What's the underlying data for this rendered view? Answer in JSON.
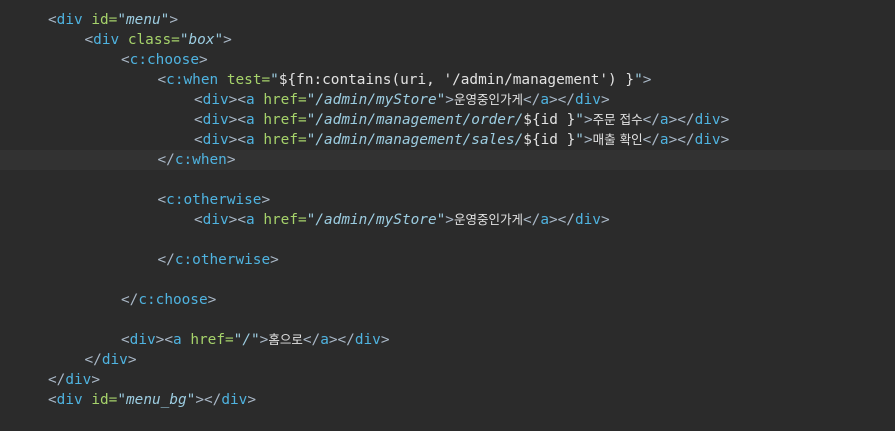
{
  "editor": {
    "background": "#2b2b2b",
    "current_line_background": "#323232",
    "current_line": 7,
    "token_colors": {
      "punctuation": "#a9b7c6",
      "tag": "#4fb3e0",
      "attribute": "#a6d36b",
      "value": "#9ccce0",
      "text": "#e2e2e2"
    },
    "lines": [
      {
        "indent": 0,
        "tokens": [
          [
            "punct",
            "<"
          ],
          [
            "tag",
            "div"
          ],
          [
            "punct",
            " "
          ],
          [
            "attr",
            "id="
          ],
          [
            "val",
            "\"menu\""
          ],
          [
            "punct",
            ">"
          ]
        ]
      },
      {
        "indent": 1,
        "tokens": [
          [
            "punct",
            "<"
          ],
          [
            "tag",
            "div"
          ],
          [
            "punct",
            " "
          ],
          [
            "attr",
            "class="
          ],
          [
            "val",
            "\"box\""
          ],
          [
            "punct",
            ">"
          ]
        ]
      },
      {
        "indent": 2,
        "tokens": [
          [
            "punct",
            "<"
          ],
          [
            "tag",
            "c:choose"
          ],
          [
            "punct",
            ">"
          ]
        ]
      },
      {
        "indent": 3,
        "tokens": [
          [
            "punct",
            "<"
          ],
          [
            "tag",
            "c:when"
          ],
          [
            "punct",
            " "
          ],
          [
            "attr",
            "test="
          ],
          [
            "val",
            "\""
          ],
          [
            "text",
            "${fn:contains(uri, '/admin/management') }"
          ],
          [
            "val",
            "\""
          ],
          [
            "punct",
            ">"
          ]
        ]
      },
      {
        "indent": 4,
        "tokens": [
          [
            "punct",
            "<"
          ],
          [
            "tag",
            "div"
          ],
          [
            "punct",
            "><"
          ],
          [
            "tag",
            "a"
          ],
          [
            "punct",
            " "
          ],
          [
            "attr",
            "href="
          ],
          [
            "val",
            "\"/admin/myStore\""
          ],
          [
            "punct",
            ">"
          ],
          [
            "ko",
            "운영중인가게"
          ],
          [
            "punct",
            "</"
          ],
          [
            "tag",
            "a"
          ],
          [
            "punct",
            "></"
          ],
          [
            "tag",
            "div"
          ],
          [
            "punct",
            ">"
          ]
        ]
      },
      {
        "indent": 4,
        "tokens": [
          [
            "punct",
            "<"
          ],
          [
            "tag",
            "div"
          ],
          [
            "punct",
            "><"
          ],
          [
            "tag",
            "a"
          ],
          [
            "punct",
            " "
          ],
          [
            "attr",
            "href="
          ],
          [
            "val",
            "\"/admin/management/order/"
          ],
          [
            "text",
            "${id }"
          ],
          [
            "val",
            "\""
          ],
          [
            "punct",
            ">"
          ],
          [
            "ko",
            "주문 접수"
          ],
          [
            "punct",
            "</"
          ],
          [
            "tag",
            "a"
          ],
          [
            "punct",
            "></"
          ],
          [
            "tag",
            "div"
          ],
          [
            "punct",
            ">"
          ]
        ]
      },
      {
        "indent": 4,
        "tokens": [
          [
            "punct",
            "<"
          ],
          [
            "tag",
            "div"
          ],
          [
            "punct",
            "><"
          ],
          [
            "tag",
            "a"
          ],
          [
            "punct",
            " "
          ],
          [
            "attr",
            "href="
          ],
          [
            "val",
            "\"/admin/management/sales/"
          ],
          [
            "text",
            "${id }"
          ],
          [
            "val",
            "\""
          ],
          [
            "punct",
            ">"
          ],
          [
            "ko",
            "매출 확인"
          ],
          [
            "punct",
            "</"
          ],
          [
            "tag",
            "a"
          ],
          [
            "punct",
            "></"
          ],
          [
            "tag",
            "div"
          ],
          [
            "punct",
            ">"
          ]
        ]
      },
      {
        "indent": 3,
        "tokens": [
          [
            "punct",
            "</"
          ],
          [
            "tag",
            "c:when"
          ],
          [
            "punct",
            ">"
          ]
        ]
      },
      {
        "indent": 0,
        "tokens": []
      },
      {
        "indent": 3,
        "tokens": [
          [
            "punct",
            "<"
          ],
          [
            "tag",
            "c:otherwise"
          ],
          [
            "punct",
            ">"
          ]
        ]
      },
      {
        "indent": 4,
        "tokens": [
          [
            "punct",
            "<"
          ],
          [
            "tag",
            "div"
          ],
          [
            "punct",
            "><"
          ],
          [
            "tag",
            "a"
          ],
          [
            "punct",
            " "
          ],
          [
            "attr",
            "href="
          ],
          [
            "val",
            "\"/admin/myStore\""
          ],
          [
            "punct",
            ">"
          ],
          [
            "ko",
            "운영중인가게"
          ],
          [
            "punct",
            "</"
          ],
          [
            "tag",
            "a"
          ],
          [
            "punct",
            "></"
          ],
          [
            "tag",
            "div"
          ],
          [
            "punct",
            ">"
          ]
        ]
      },
      {
        "indent": 0,
        "tokens": []
      },
      {
        "indent": 3,
        "tokens": [
          [
            "punct",
            "</"
          ],
          [
            "tag",
            "c:otherwise"
          ],
          [
            "punct",
            ">"
          ]
        ]
      },
      {
        "indent": 0,
        "tokens": []
      },
      {
        "indent": 2,
        "tokens": [
          [
            "punct",
            "</"
          ],
          [
            "tag",
            "c:choose"
          ],
          [
            "punct",
            ">"
          ]
        ]
      },
      {
        "indent": 0,
        "tokens": []
      },
      {
        "indent": 2,
        "tokens": [
          [
            "punct",
            "<"
          ],
          [
            "tag",
            "div"
          ],
          [
            "punct",
            "><"
          ],
          [
            "tag",
            "a"
          ],
          [
            "punct",
            " "
          ],
          [
            "attr",
            "href="
          ],
          [
            "val",
            "\"/\""
          ],
          [
            "punct",
            ">"
          ],
          [
            "ko",
            "홈으로"
          ],
          [
            "punct",
            "</"
          ],
          [
            "tag",
            "a"
          ],
          [
            "punct",
            "></"
          ],
          [
            "tag",
            "div"
          ],
          [
            "punct",
            ">"
          ]
        ]
      },
      {
        "indent": 1,
        "tokens": [
          [
            "punct",
            "</"
          ],
          [
            "tag",
            "div"
          ],
          [
            "punct",
            ">"
          ]
        ]
      },
      {
        "indent": 0,
        "tokens": [
          [
            "punct",
            "</"
          ],
          [
            "tag",
            "div"
          ],
          [
            "punct",
            ">"
          ]
        ]
      },
      {
        "indent": 0,
        "tokens": [
          [
            "punct",
            "<"
          ],
          [
            "tag",
            "div"
          ],
          [
            "punct",
            " "
          ],
          [
            "attr",
            "id="
          ],
          [
            "val",
            "\"menu_bg\""
          ],
          [
            "punct",
            "></"
          ],
          [
            "tag",
            "div"
          ],
          [
            "punct",
            ">"
          ]
        ]
      }
    ]
  }
}
